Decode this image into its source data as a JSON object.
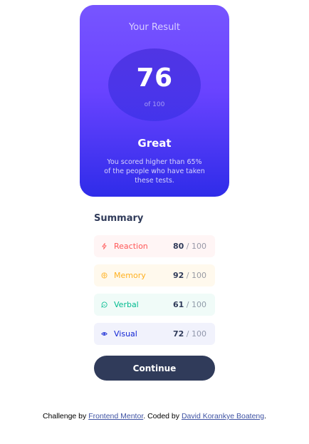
{
  "result": {
    "heading": "Your Result",
    "score": "76",
    "score_of": "of 100",
    "grade": "Great",
    "description": "You scored higher than 65% of the people who have taken these tests."
  },
  "summary": {
    "title": "Summary",
    "items": [
      {
        "label": "Reaction",
        "score": "80",
        "total": "/ 100",
        "icon": "lightning-icon",
        "color": "#FF5757"
      },
      {
        "label": "Memory",
        "score": "92",
        "total": "/ 100",
        "icon": "brain-icon",
        "color": "#FFB01F"
      },
      {
        "label": "Verbal",
        "score": "61",
        "total": "/ 100",
        "icon": "speech-bubble-icon",
        "color": "#00BB8F"
      },
      {
        "label": "Visual",
        "score": "72",
        "total": "/ 100",
        "icon": "eye-icon",
        "color": "#1125D4"
      }
    ],
    "continue_label": "Continue"
  },
  "attribution": {
    "prefix": "Challenge by ",
    "link1": "Frontend Mentor",
    "middle": ". Coded by ",
    "link2": "David Korankye Boateng",
    "suffix": "."
  },
  "colors": {
    "card_top": "#7755FF",
    "card_bottom": "#2F2CE9",
    "dark_navy": "#303B5A",
    "link": "#3E52A3"
  }
}
